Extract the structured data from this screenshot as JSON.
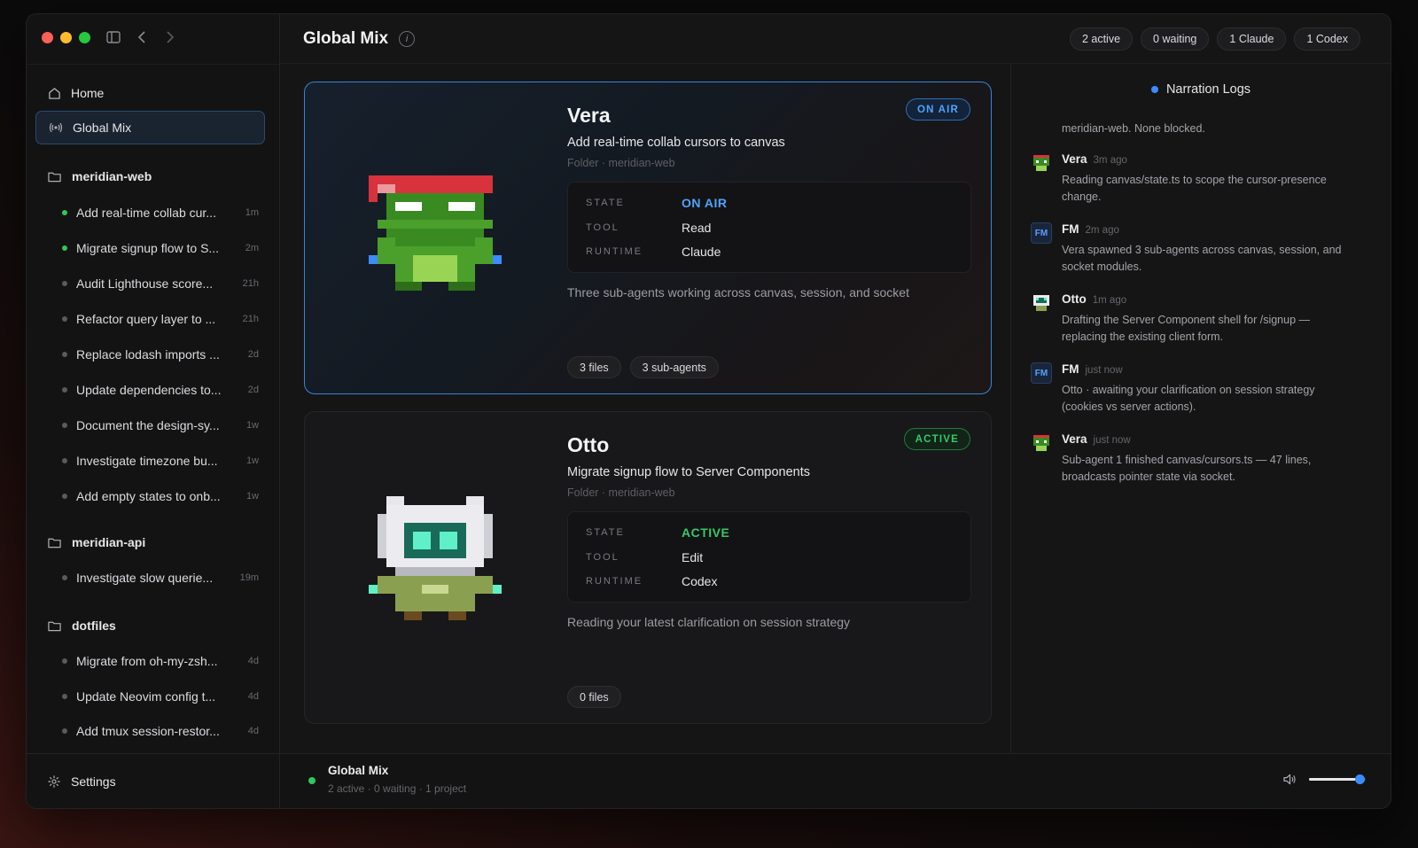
{
  "sidebar": {
    "nav": [
      {
        "label": "Home",
        "icon": "home-icon"
      },
      {
        "label": "Global Mix",
        "icon": "broadcast-icon"
      }
    ],
    "groups": [
      {
        "name": "meridian-web",
        "tasks": [
          {
            "label": "Add real-time collab cur...",
            "age": "1m",
            "active": true
          },
          {
            "label": "Migrate signup flow to S...",
            "age": "2m",
            "active": true
          },
          {
            "label": "Audit Lighthouse score...",
            "age": "21h",
            "active": false
          },
          {
            "label": "Refactor query layer to ...",
            "age": "21h",
            "active": false
          },
          {
            "label": "Replace lodash imports ...",
            "age": "2d",
            "active": false
          },
          {
            "label": "Update dependencies to...",
            "age": "2d",
            "active": false
          },
          {
            "label": "Document the design-sy...",
            "age": "1w",
            "active": false
          },
          {
            "label": "Investigate timezone bu...",
            "age": "1w",
            "active": false
          },
          {
            "label": "Add empty states to onb...",
            "age": "1w",
            "active": false
          }
        ]
      },
      {
        "name": "meridian-api",
        "tasks": [
          {
            "label": "Investigate slow querie...",
            "age": "19m",
            "active": false
          }
        ]
      },
      {
        "name": "dotfiles",
        "tasks": [
          {
            "label": "Migrate from oh-my-zsh...",
            "age": "4d",
            "active": false
          },
          {
            "label": "Update Neovim config t...",
            "age": "4d",
            "active": false
          },
          {
            "label": "Add tmux session-restor...",
            "age": "4d",
            "active": false
          }
        ]
      }
    ],
    "settings_label": "Settings"
  },
  "header": {
    "title": "Global Mix",
    "pills": [
      "2 active",
      "0 waiting",
      "1 Claude",
      "1 Codex"
    ]
  },
  "cards": [
    {
      "name": "Vera",
      "badge": "ON AIR",
      "task": "Add real-time collab cursors to canvas",
      "folder": "Folder · meridian-web",
      "state_key": "STATE",
      "state": "ON AIR",
      "tool_key": "TOOL",
      "tool": "Read",
      "runtime_key": "RUNTIME",
      "runtime": "Claude",
      "description": "Three sub-agents working across canvas, session, and socket",
      "chips": [
        "3 files",
        "3 sub-agents"
      ]
    },
    {
      "name": "Otto",
      "badge": "ACTIVE",
      "task": "Migrate signup flow to Server Components",
      "folder": "Folder · meridian-web",
      "state_key": "STATE",
      "state": "ACTIVE",
      "tool_key": "TOOL",
      "tool": "Edit",
      "runtime_key": "RUNTIME",
      "runtime": "Codex",
      "description": "Reading your latest clarification on session strategy",
      "chips": [
        "0 files"
      ]
    }
  ],
  "panel": {
    "title": "Narration Logs",
    "partial_top": "meridian-web. None blocked.",
    "logs": [
      {
        "name": "Vera",
        "time": "3m ago",
        "avatar": "frog",
        "text": "Reading canvas/state.ts to scope the cursor-presence change."
      },
      {
        "name": "FM",
        "time": "2m ago",
        "avatar": "FM",
        "text": "Vera spawned 3 sub-agents across canvas, session, and socket modules."
      },
      {
        "name": "Otto",
        "time": "1m ago",
        "avatar": "robot",
        "text": "Drafting the Server Component shell for /signup — replacing the existing client form."
      },
      {
        "name": "FM",
        "time": "just now",
        "avatar": "FM",
        "text": "Otto · awaiting your clarification on session strategy (cookies vs server actions)."
      },
      {
        "name": "Vera",
        "time": "just now",
        "avatar": "frog",
        "text": "Sub-agent 1 finished canvas/cursors.ts — 47 lines, broadcasts pointer state via socket."
      }
    ]
  },
  "footer": {
    "title": "Global Mix",
    "subtitle": "2 active · 0 waiting · 1 project",
    "volume": 0.9
  },
  "colors": {
    "accent_blue": "#3b8cff",
    "active_green": "#35c868",
    "on_air_blue": "#4fa3ff"
  }
}
